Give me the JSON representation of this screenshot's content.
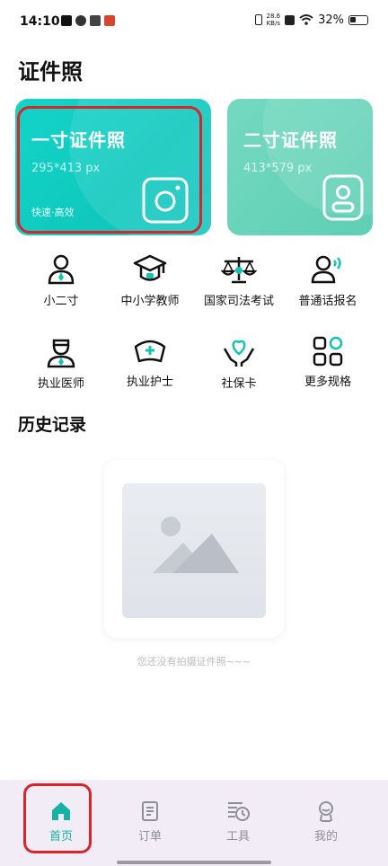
{
  "status_bar": {
    "time": "14:10",
    "net_speed_top": "28.6",
    "net_speed_unit": "KB/s",
    "battery": "32%"
  },
  "page": {
    "title": "证件照"
  },
  "cards": [
    {
      "title": "一寸证件照",
      "size": "295*413 px",
      "tag": "快速·高效",
      "icon": "camera-icon"
    },
    {
      "title": "二寸证件照",
      "size": "413*579 px",
      "icon": "id-card-icon"
    }
  ],
  "categories": [
    {
      "label": "小二寸",
      "icon": "person-tie-icon"
    },
    {
      "label": "中小学教师",
      "icon": "graduation-cap-icon"
    },
    {
      "label": "国家司法考试",
      "icon": "scales-icon"
    },
    {
      "label": "普通话报名",
      "icon": "speaking-person-icon"
    },
    {
      "label": "执业医师",
      "icon": "doctor-icon"
    },
    {
      "label": "执业护士",
      "icon": "nurse-cap-icon"
    },
    {
      "label": "社保卡",
      "icon": "heart-hands-icon"
    },
    {
      "label": "更多规格",
      "icon": "grid-icon"
    }
  ],
  "history": {
    "title": "历史记录",
    "empty_text": "您还没有拍摄证件照~~~"
  },
  "tabs": [
    {
      "label": "首页",
      "icon": "home-icon",
      "active": true
    },
    {
      "label": "订单",
      "icon": "order-icon"
    },
    {
      "label": "工具",
      "icon": "tools-icon"
    },
    {
      "label": "我的",
      "icon": "profile-icon"
    }
  ],
  "colors": {
    "accent": "#14b3a6",
    "card1": "#13d4c8",
    "card2": "#5fcfb3",
    "highlight": "#d9252a"
  }
}
